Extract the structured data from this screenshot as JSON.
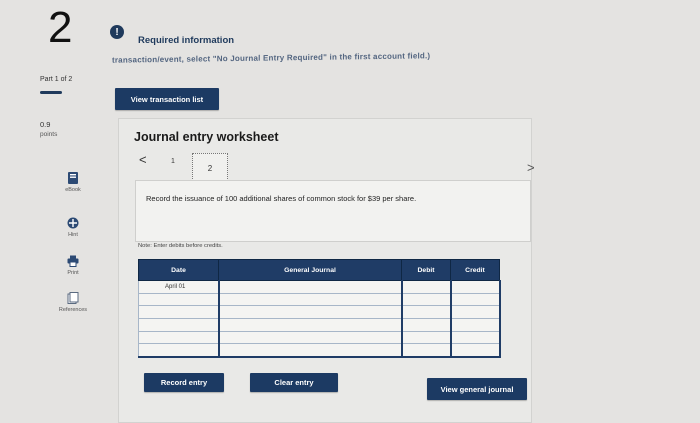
{
  "question": {
    "number": "2"
  },
  "required_info": {
    "icon": "!",
    "label": "Required information"
  },
  "cut_off_text": "transaction/event, select \"No Journal Entry Required\" in the first account field.)",
  "sidebar": {
    "part": "Part 1 of 2",
    "points_value": "0.9",
    "points_label": "points",
    "items": [
      {
        "label": "eBook",
        "icon": "ebook-icon"
      },
      {
        "label": "Hint",
        "icon": "hint-icon"
      },
      {
        "label": "Print",
        "icon": "print-icon"
      },
      {
        "label": "References",
        "icon": "references-icon"
      }
    ]
  },
  "buttons": {
    "view_transaction_list": "View transaction list",
    "record_entry": "Record entry",
    "clear_entry": "Clear entry",
    "view_general_journal": "View general journal"
  },
  "worksheet": {
    "title": "Journal entry worksheet",
    "nav_prev": "<",
    "nav_next": ">",
    "tabs": [
      "1",
      "2"
    ],
    "instruction": "Record the issuance of 100 additional shares of common stock for $39 per share.",
    "note": "Note: Enter debits before credits."
  },
  "journal_table": {
    "headers": [
      "Date",
      "General Journal",
      "Debit",
      "Credit"
    ],
    "rows": [
      {
        "date": "April 01",
        "account": "",
        "debit": "",
        "credit": ""
      },
      {
        "date": "",
        "account": "",
        "debit": "",
        "credit": ""
      },
      {
        "date": "",
        "account": "",
        "debit": "",
        "credit": ""
      },
      {
        "date": "",
        "account": "",
        "debit": "",
        "credit": ""
      },
      {
        "date": "",
        "account": "",
        "debit": "",
        "credit": ""
      },
      {
        "date": "",
        "account": "",
        "debit": "",
        "credit": ""
      }
    ]
  },
  "colors": {
    "primary_navy": "#1c3a63",
    "background": "#e4e3e1"
  }
}
